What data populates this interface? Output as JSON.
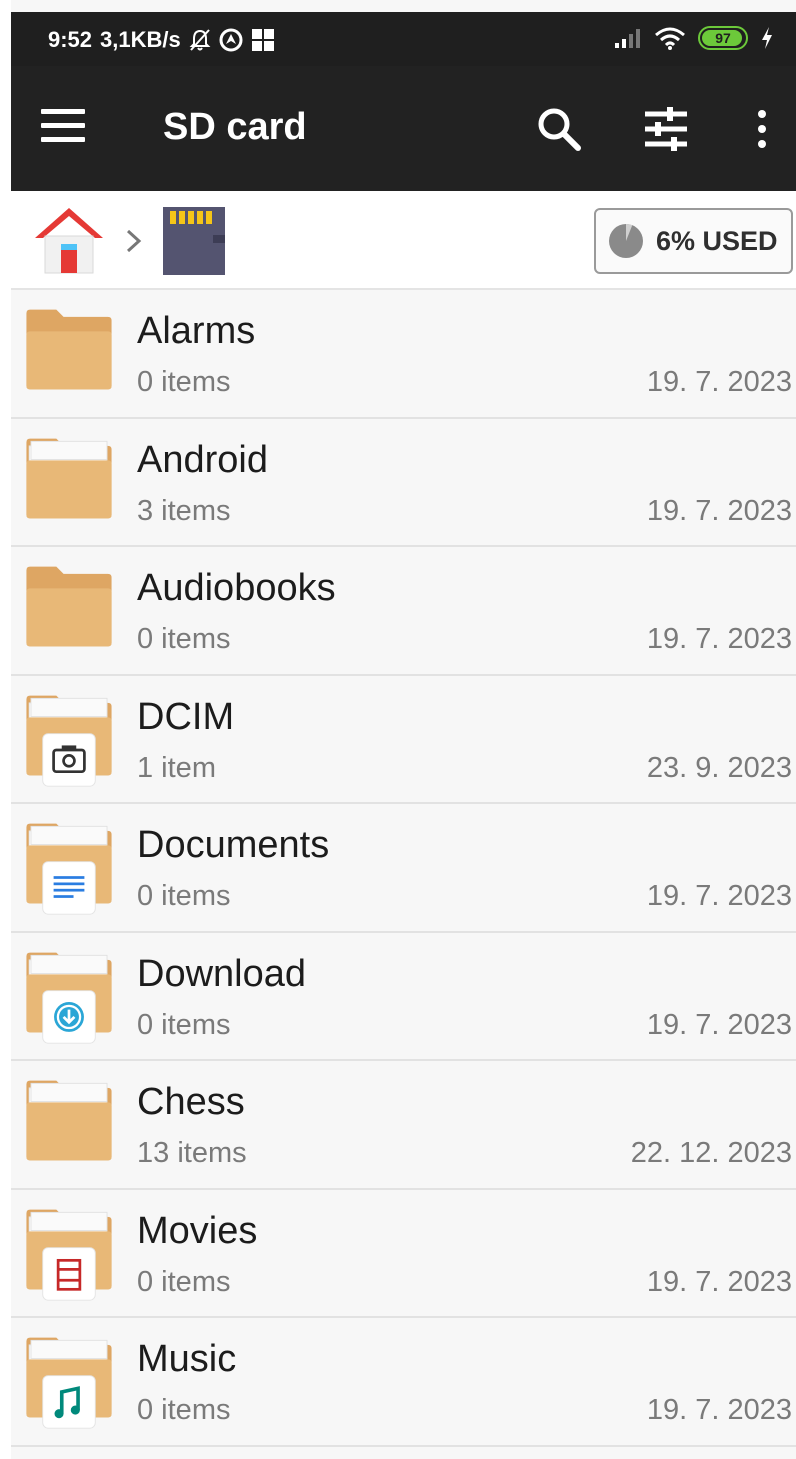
{
  "status_bar": {
    "time": "9:52",
    "speed": "3,1KB/s",
    "battery": "97",
    "icons": [
      "bell-off-icon",
      "location-icon",
      "notification-icon",
      "signal-icon",
      "wifi-icon",
      "charging-icon"
    ]
  },
  "app_bar": {
    "title": "SD card",
    "icons": [
      "menu-icon",
      "search-icon",
      "filter-icon",
      "more-vert-icon"
    ]
  },
  "breadcrumb": {
    "icons": [
      "home-icon",
      "chevron-right-icon",
      "sd-card-icon"
    ],
    "usage_label": "6% USED",
    "usage_fraction": 0.06
  },
  "colors": {
    "app_bar": "#222222",
    "folder": "#e8b877",
    "folder_dark": "#dea663"
  },
  "files": [
    {
      "name": "Alarms",
      "count": "0 items",
      "date": "19. 7. 2023",
      "icon": "folder-icon"
    },
    {
      "name": "Android",
      "count": "3 items",
      "date": "19. 7. 2023",
      "icon": "folder-with-files-icon"
    },
    {
      "name": "Audiobooks",
      "count": "0 items",
      "date": "19. 7. 2023",
      "icon": "folder-icon"
    },
    {
      "name": "DCIM",
      "count": "1 item",
      "date": "23. 9. 2023",
      "icon": "camera-folder-icon"
    },
    {
      "name": "Documents",
      "count": "0 items",
      "date": "19. 7. 2023",
      "icon": "document-folder-icon"
    },
    {
      "name": "Download",
      "count": "0 items",
      "date": "19. 7. 2023",
      "icon": "download-folder-icon"
    },
    {
      "name": "Chess",
      "count": "13 items",
      "date": "22. 12. 2023",
      "icon": "folder-with-files-icon"
    },
    {
      "name": "Movies",
      "count": "0 items",
      "date": "19. 7. 2023",
      "icon": "movie-folder-icon"
    },
    {
      "name": "Music",
      "count": "0 items",
      "date": "19. 7. 2023",
      "icon": "music-folder-icon"
    }
  ]
}
